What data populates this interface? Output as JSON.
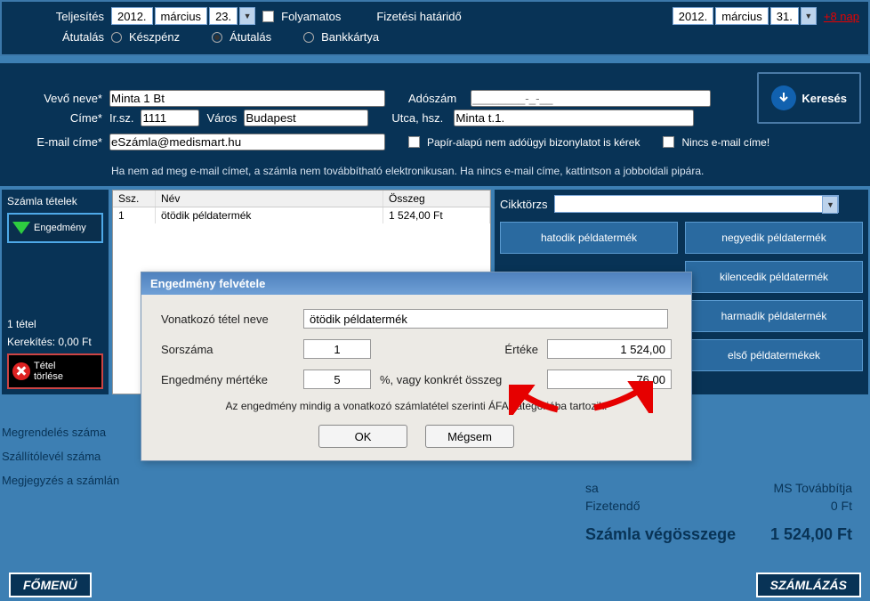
{
  "header": {
    "teljesites_label": "Teljesítés",
    "teljesites_date": {
      "y": "2012.",
      "m": "március",
      "d": "23."
    },
    "folyamatos_label": "Folyamatos",
    "fizetesi_label": "Fizetési határidő",
    "fizetesi_date": {
      "y": "2012.",
      "m": "március",
      "d": "31."
    },
    "plus_days": "+8 nap",
    "atutalas_label": "Átutalás",
    "pay_opts": {
      "keszpenz": "Készpénz",
      "atutalas": "Átutalás",
      "bankkartya": "Bankkártya"
    }
  },
  "customer": {
    "vevo_label": "Vevő neve*",
    "vevo_value": "Minta 1 Bt",
    "adoszam_label": "Adószám",
    "adoszam_value": "________-_-__",
    "cim_label": "Címe*",
    "irsz_label": "Ir.sz.",
    "irsz_value": "1111",
    "varos_label": "Város",
    "varos_value": "Budapest",
    "utca_label": "Utca, hsz.",
    "utca_value": "Minta t.1.",
    "email_label": "E-mail címe*",
    "email_value": "eSzámla@medismart.hu",
    "papir_label": "Papír-alapú nem adóügyi bizonylatot is kérek",
    "nincs_email_label": "Nincs e-mail címe!",
    "kereses_label": "Keresés",
    "note": "Ha nem ad meg e-mail címet, a számla nem továbbítható elektronikusan. Ha nincs e-mail címe, kattintson a jobboldali pipára."
  },
  "items": {
    "side_title": "Számla tételek",
    "engedmeny_btn": "Engedmény",
    "tetel_count": "1 tétel",
    "kerekites": "Kerekítés: 0,00 Ft",
    "delete_btn_l1": "Tétel",
    "delete_btn_l2": "törlése",
    "grid_head": {
      "ssz": "Ssz.",
      "nev": "Név",
      "osszeg": "Összeg"
    },
    "rows": [
      {
        "ssz": "1",
        "nev": "ötödik példatermék",
        "osszeg": "1 524,00 Ft"
      }
    ]
  },
  "products": {
    "cikktorzs_label": "Cikktörzs",
    "buttons": [
      "hatodik példatermék",
      "negyedik példatermék",
      "",
      "kilencedik példatermék",
      "",
      "harmadik példatermék",
      "",
      "első példatermékek"
    ]
  },
  "bottom": {
    "megrendeles": "Megrendelés száma",
    "szallito": "Szállítólevél száma",
    "megjegyzes": "Megjegyzés a számlán"
  },
  "totals": {
    "sa_label": "sa",
    "sa_value": "MS Továbbítja",
    "fizetendo_label": "Fizetendő",
    "fizetendo_value": "0 Ft",
    "vegosszeg_label": "Számla végösszege",
    "vegosszeg_value": "1 524,00 Ft"
  },
  "footer": {
    "fomenu": "FŐMENÜ",
    "szamlazas": "SZÁMLÁZÁS"
  },
  "modal": {
    "title": "Engedmény felvétele",
    "tetelnev_label": "Vonatkozó tétel neve",
    "tetelnev_value": "ötödik példatermék",
    "sorszam_label": "Sorszáma",
    "sorszam_value": "1",
    "ertek_label": "Értéke",
    "ertek_value": "1 524,00",
    "mertek_label": "Engedmény mértéke",
    "mertek_value": "5",
    "percent_or": "%, vagy konkrét összeg",
    "osszeg_value": "76,00",
    "note": "Az engedmény mindig a vonatkozó számlatétel szerinti ÁFA kategóriába tartozik.",
    "ok": "OK",
    "megsem": "Mégsem"
  }
}
